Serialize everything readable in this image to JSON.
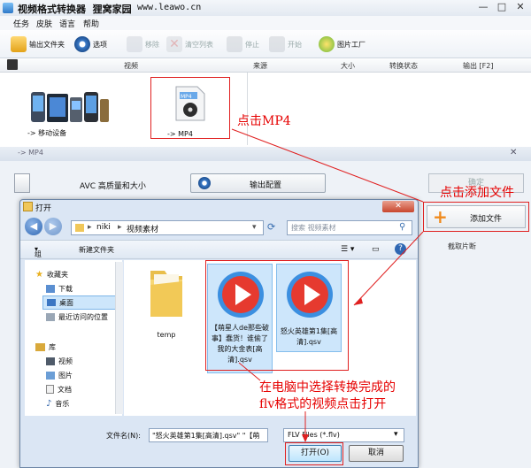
{
  "app": {
    "title": "视频格式转换器",
    "brand": "狸窝家园",
    "url": "www.leawo.cn",
    "menu": [
      "任务",
      "皮肤",
      "语言",
      "帮助"
    ],
    "toolbar": {
      "output_folder": "输出文件夹",
      "options": "选项",
      "remove": "移除",
      "clear_list": "清空列表",
      "stop": "停止",
      "start": "开始",
      "image_factory": "图片工厂"
    },
    "list_headers": {
      "video": "视频",
      "source": "来源",
      "size": "大小",
      "status": "转换状态",
      "output": "输出 [F2]"
    },
    "tiles": {
      "mobile": "-> 移动设备",
      "mp4": "-> MP4"
    }
  },
  "mp4_window": {
    "title": "-> MP4",
    "quality": "AVC 高质量和大小",
    "export_config": "输出配置",
    "confirm": "确定",
    "add_file": "添加文件",
    "clip_column": "截取片断"
  },
  "open_dialog": {
    "title": "打开",
    "path": [
      "niki",
      "视频素材"
    ],
    "search_placeholder": "搜索 视频素材",
    "organize": "组织",
    "new_folder": "新建文件夹",
    "nav": {
      "favorites": "收藏夹",
      "downloads": "下载",
      "desktop": "桌面",
      "recent": "最近访问的位置",
      "library": "库",
      "videos": "视频",
      "pictures": "图片",
      "documents": "文档",
      "music": "音乐"
    },
    "files": {
      "folder": "temp",
      "file1": "【萌星人de那些破事】蠢货！谁偷了我的大金表[高清].qsv",
      "file2": "怒火英雄第1集[高清].qsv"
    },
    "filename_label": "文件名(N):",
    "filename_value": "\"怒火英雄第1集[高清].qsv\" \"【萌",
    "filetype": "FLV Files (*.flv)",
    "open": "打开(O)",
    "cancel": "取消"
  },
  "annotations": {
    "click_mp4": "点击MP4",
    "click_add": "点击添加文件",
    "instruction_line1": "在电脑中选择转换完成的",
    "instruction_line2": "flv格式的视频点击打开"
  },
  "colors": {
    "annotation_red": "#e60000",
    "accent_blue": "#2f67b3",
    "play_red": "#e63a2f",
    "file_select_blue": "#cde6fb"
  }
}
